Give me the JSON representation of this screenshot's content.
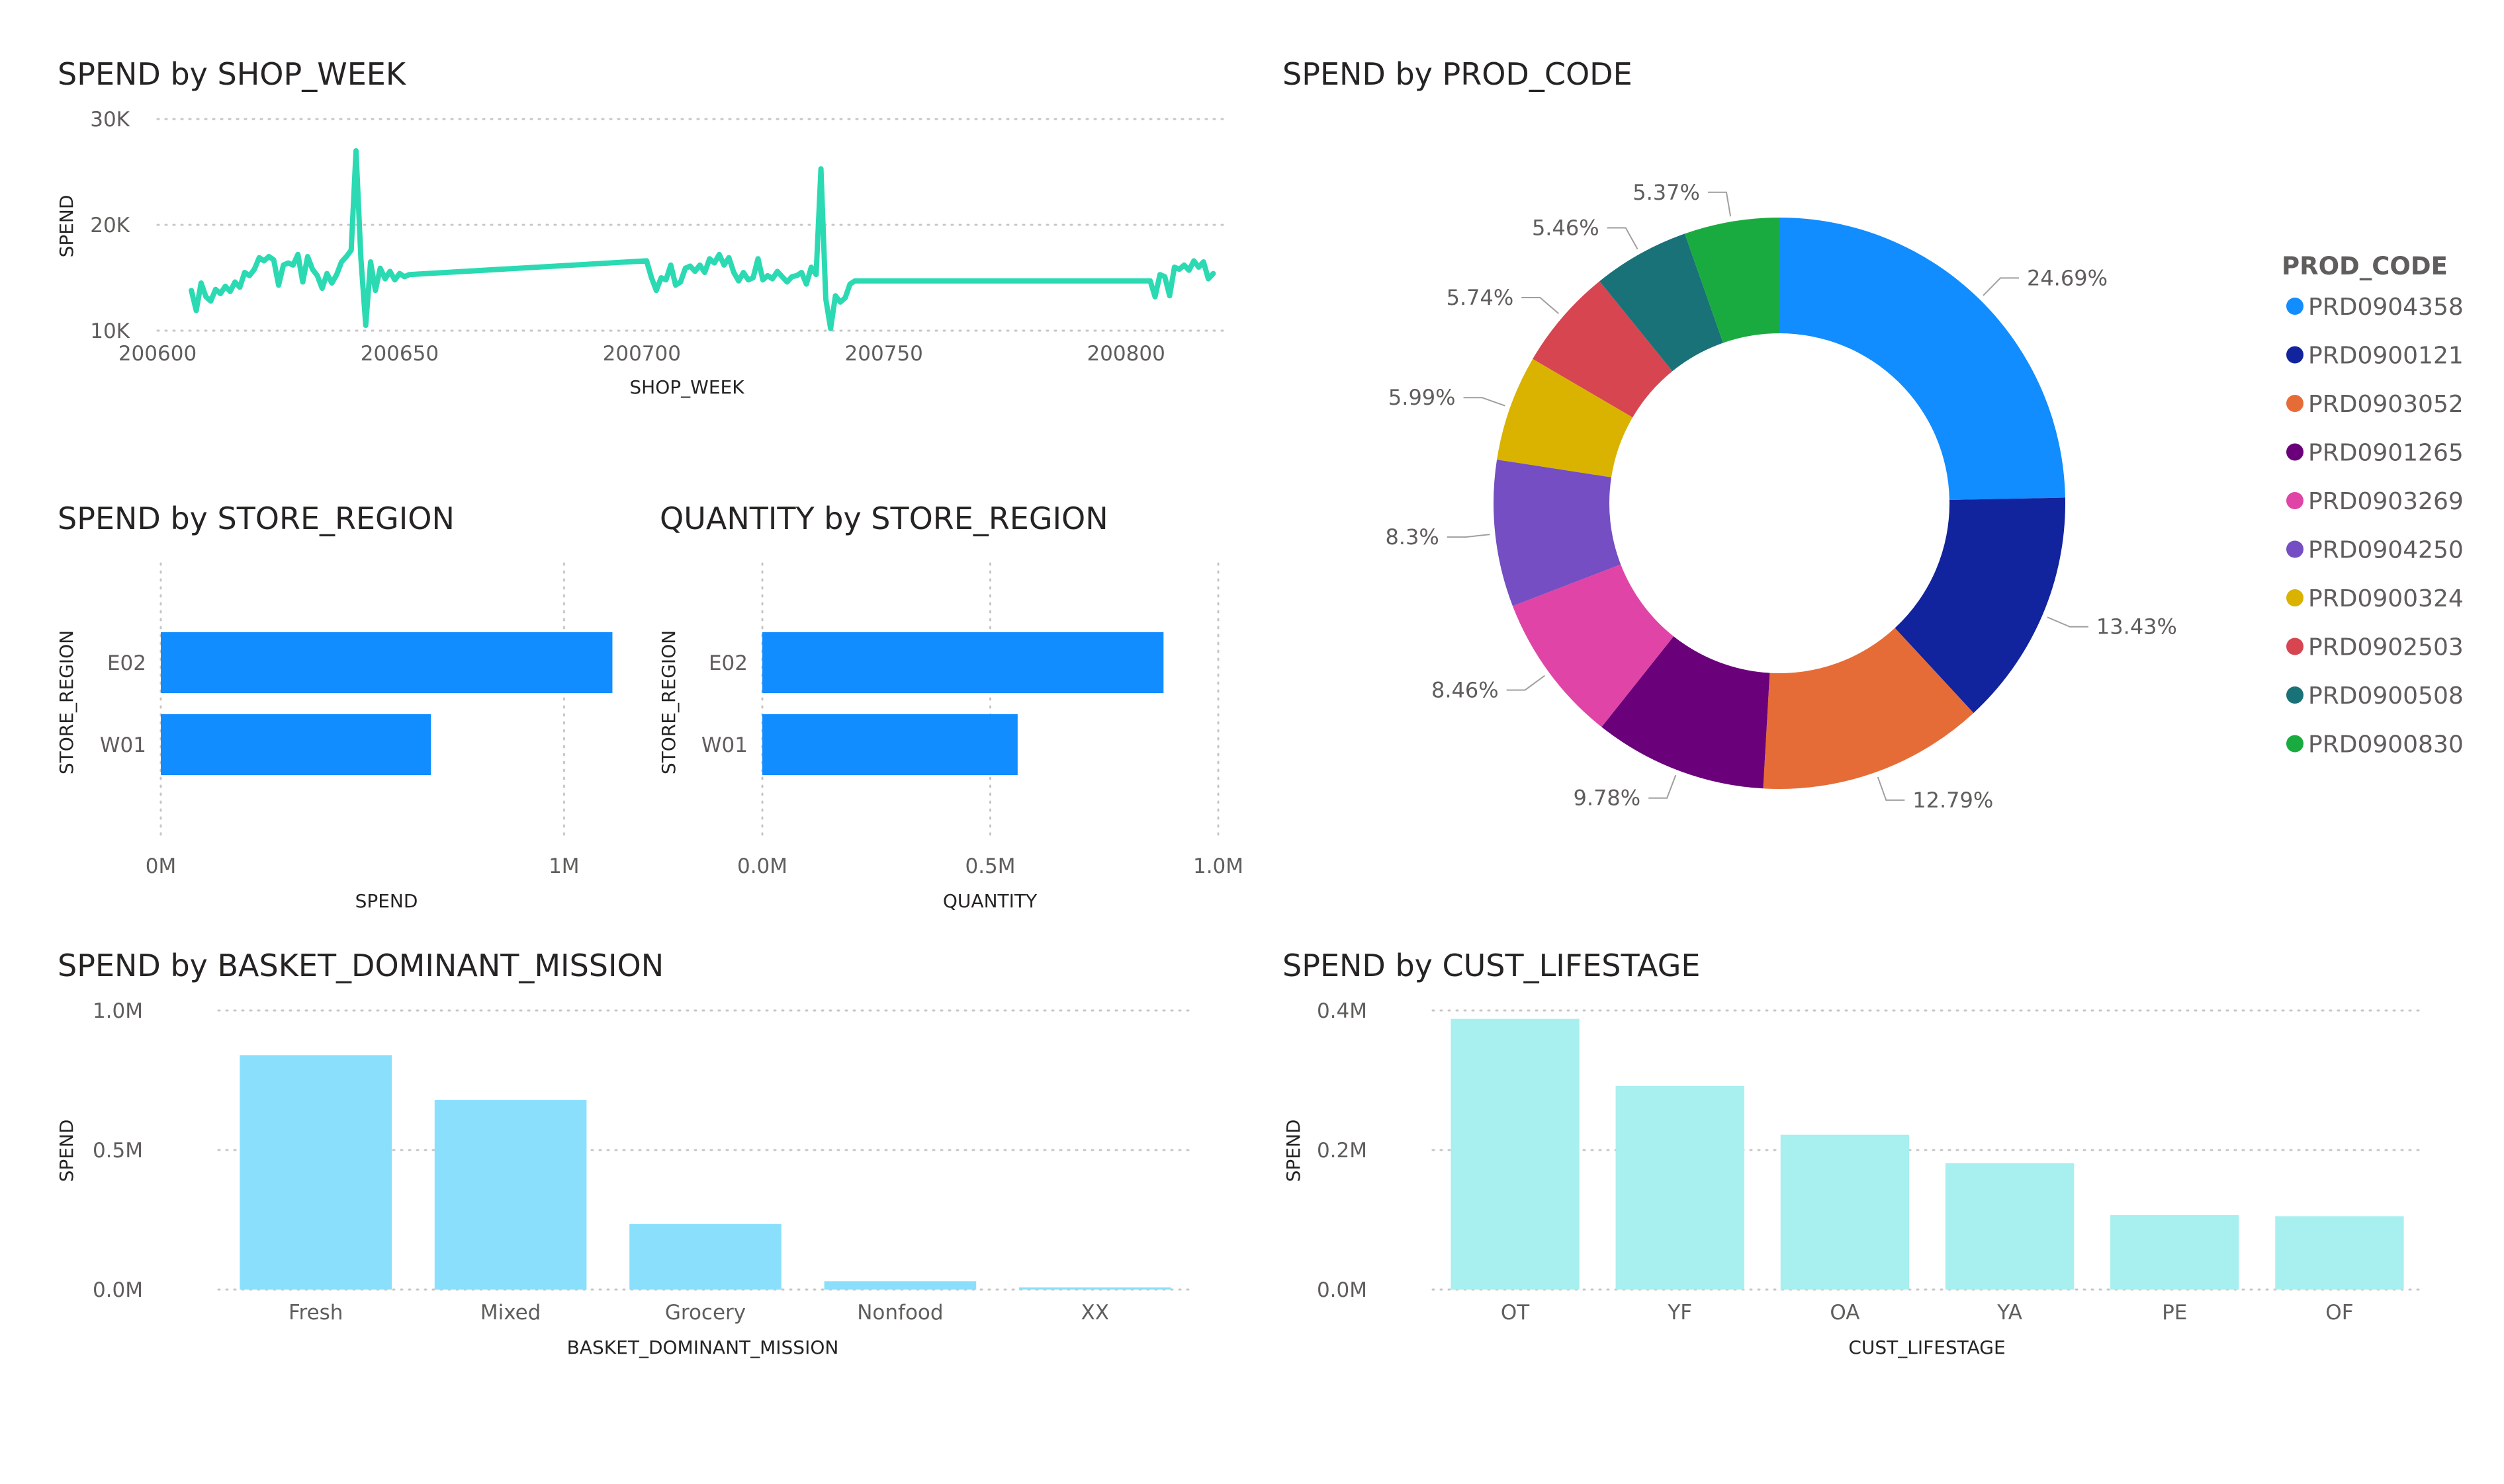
{
  "chart_data": [
    {
      "id": "week",
      "type": "line",
      "title": "SPEND by SHOP_WEEK",
      "xlabel": "SHOP_WEEK",
      "ylabel": "SPEND",
      "xlim": [
        200600,
        200820
      ],
      "ylim": [
        10000,
        30000
      ],
      "x_ticks": [
        200600,
        200650,
        200700,
        200750,
        200800
      ],
      "y_ticks": [
        10000,
        20000,
        30000
      ],
      "y_tick_labels": [
        "10K",
        "20K",
        "30K"
      ],
      "grid": true,
      "color": "#2bdab2",
      "x": [
        200607,
        200608,
        200609,
        200610,
        200611,
        200612,
        200613,
        200614,
        200615,
        200616,
        200617,
        200618,
        200619,
        200620,
        200621,
        200622,
        200623,
        200624,
        200625,
        200626,
        200627,
        200628,
        200629,
        200630,
        200631,
        200632,
        200633,
        200634,
        200635,
        200636,
        200637,
        200638,
        200639,
        200640,
        200641,
        200642,
        200643,
        200644,
        200645,
        200646,
        200647,
        200648,
        200649,
        200650,
        200651,
        200652,
        200701,
        200702,
        200703,
        200704,
        200705,
        200706,
        200707,
        200708,
        200709,
        200710,
        200711,
        200712,
        200713,
        200714,
        200715,
        200716,
        200717,
        200718,
        200719,
        200720,
        200721,
        200722,
        200723,
        200724,
        200725,
        200726,
        200727,
        200728,
        200729,
        200730,
        200731,
        200732,
        200733,
        200734,
        200735,
        200736,
        200737,
        200738,
        200739,
        200740,
        200741,
        200742,
        200743,
        200744,
        200745,
        200746,
        200747,
        200748,
        200749,
        200750,
        200751,
        200752,
        200801,
        200802,
        200803,
        200804,
        200805,
        200806,
        200807,
        200808,
        200809,
        200810,
        200811,
        200812,
        200813,
        200814,
        200815,
        200816,
        200817,
        200818
      ],
      "values": [
        13800,
        11900,
        14500,
        13200,
        12800,
        13900,
        13500,
        14200,
        13700,
        14600,
        14100,
        15500,
        15200,
        15800,
        16900,
        16600,
        17000,
        16700,
        14300,
        16200,
        16400,
        16200,
        17200,
        14600,
        17000,
        15800,
        15200,
        14000,
        15400,
        14500,
        15300,
        16500,
        17000,
        17600,
        27000,
        16800,
        10500,
        16500,
        13800,
        15900,
        14900,
        15600,
        14800,
        15400,
        15100,
        15300,
        16600,
        15000,
        13800,
        15000,
        14800,
        16200,
        14300,
        14600,
        15900,
        16100,
        15600,
        16200,
        15500,
        16800,
        16400,
        17200,
        16200,
        16900,
        15500,
        14700,
        15500,
        14800,
        15000,
        16800,
        14800,
        15200,
        14900,
        15600,
        15100,
        14600,
        15100,
        15200,
        15500,
        14400,
        16000,
        15300,
        25300,
        13000,
        10200,
        13300,
        12700,
        13100,
        14400,
        14700,
        14700,
        14700,
        14700,
        14700,
        14700,
        14700,
        14700,
        14700,
        14700,
        14700,
        14700,
        14700,
        14700,
        13200,
        15300,
        15100,
        13300,
        16000,
        15800,
        16200,
        15700,
        16600,
        16000,
        16500,
        14900,
        15400
      ]
    },
    {
      "id": "region_spend",
      "type": "bar",
      "orientation": "horizontal",
      "title": "SPEND by STORE_REGION",
      "xlabel": "SPEND",
      "ylabel": "STORE_REGION",
      "categories": [
        "E02",
        "W01"
      ],
      "values": [
        1120000,
        670000
      ],
      "xlim": [
        0,
        1500000
      ],
      "x_ticks": [
        0,
        1000000
      ],
      "x_tick_labels": [
        "0M",
        "1M"
      ],
      "grid": true,
      "color": "#118dff"
    },
    {
      "id": "region_qty",
      "type": "bar",
      "orientation": "horizontal",
      "title": "QUANTITY by STORE_REGION",
      "xlabel": "QUANTITY",
      "ylabel": "STORE_REGION",
      "categories": [
        "E02",
        "W01"
      ],
      "values": [
        880000,
        560000
      ],
      "xlim": [
        0,
        1000000
      ],
      "x_ticks": [
        0,
        500000,
        1000000
      ],
      "x_tick_labels": [
        "0.0M",
        "0.5M",
        "1.0M"
      ],
      "grid": true,
      "color": "#118dff"
    },
    {
      "id": "mission",
      "type": "bar",
      "title": "SPEND by BASKET_DOMINANT_MISSION",
      "xlabel": "BASKET_DOMINANT_MISSION",
      "ylabel": "SPEND",
      "categories": [
        "Fresh",
        "Mixed",
        "Grocery",
        "Nonfood",
        "XX"
      ],
      "values": [
        840000,
        680000,
        235000,
        30000,
        8000
      ],
      "ylim": [
        0,
        1000000
      ],
      "y_ticks": [
        0,
        500000,
        1000000
      ],
      "y_tick_labels": [
        "0.0M",
        "0.5M",
        "1.0M"
      ],
      "grid": true,
      "color": "#8ae0fc"
    },
    {
      "id": "lifestage",
      "type": "bar",
      "title": "SPEND by CUST_LIFESTAGE",
      "xlabel": "CUST_LIFESTAGE",
      "ylabel": "SPEND",
      "categories": [
        "OT",
        "YF",
        "OA",
        "YA",
        "PE",
        "OF"
      ],
      "values": [
        388000,
        292000,
        222000,
        181000,
        107000,
        105000
      ],
      "ylim": [
        0,
        400000
      ],
      "y_ticks": [
        0,
        200000,
        400000
      ],
      "y_tick_labels": [
        "0.0M",
        "0.2M",
        "0.4M"
      ],
      "grid": true,
      "color": "#a8eff0"
    },
    {
      "id": "prod",
      "type": "pie",
      "subtype": "donut",
      "title": "SPEND by PROD_CODE",
      "legend_title": "PROD_CODE",
      "legend_position": "right",
      "categories": [
        "PRD0904358",
        "PRD0900121",
        "PRD0903052",
        "PRD0901265",
        "PRD0903269",
        "PRD0904250",
        "PRD0900324",
        "PRD0902503",
        "PRD0900508",
        "PRD0900830"
      ],
      "values": [
        24.69,
        13.43,
        12.79,
        9.78,
        8.46,
        8.3,
        5.99,
        5.74,
        5.46,
        5.37
      ],
      "value_labels": [
        "24.69%",
        "13.43%",
        "12.79%",
        "9.78%",
        "8.46%",
        "8.3%",
        "5.99%",
        "5.74%",
        "5.46%",
        "5.37%"
      ],
      "colors": [
        "#118dff",
        "#12239e",
        "#e66c37",
        "#6b007b",
        "#e044a7",
        "#744ec2",
        "#d9b300",
        "#d64550",
        "#197278",
        "#1aab40"
      ]
    }
  ]
}
